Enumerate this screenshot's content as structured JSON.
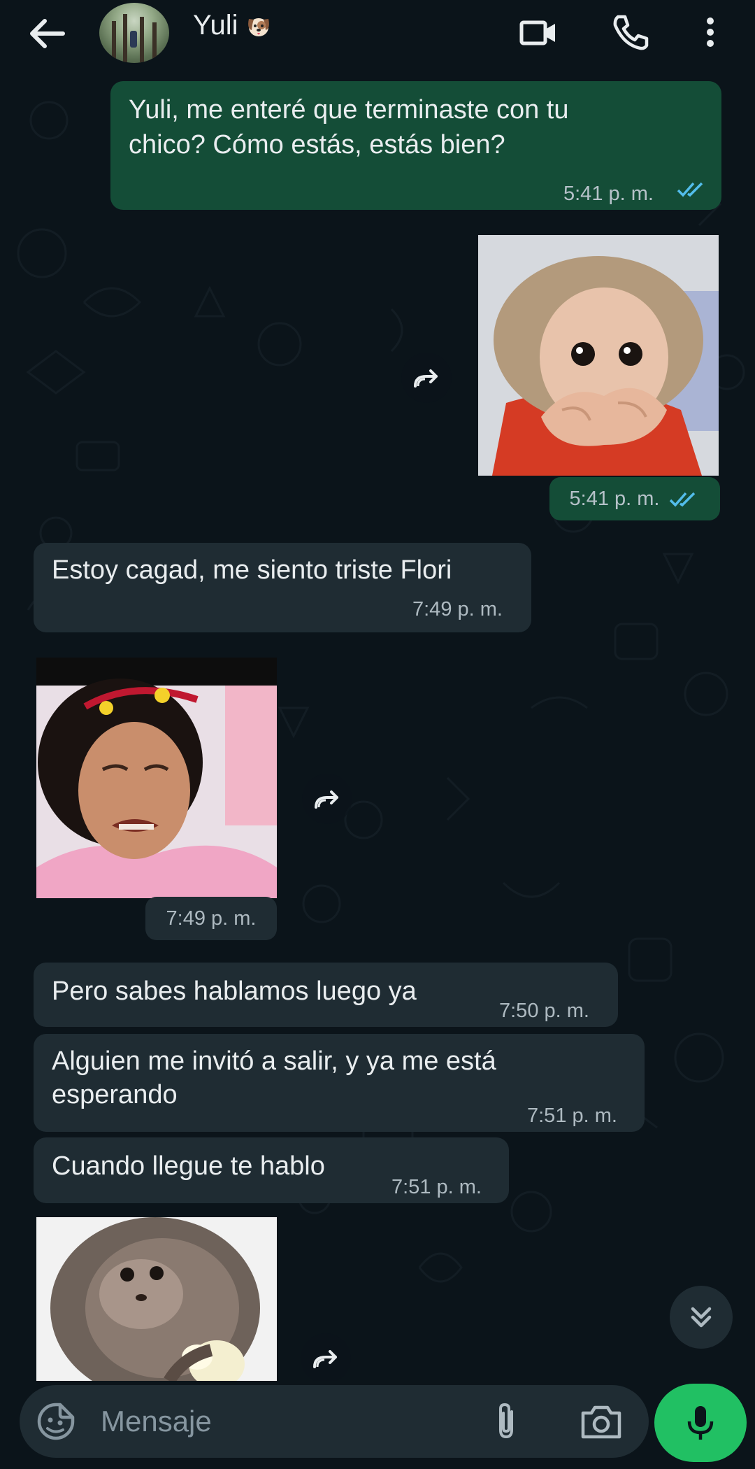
{
  "header": {
    "contact_name": "Yuli",
    "contact_emoji": "dog-face-emoji"
  },
  "messages": [
    {
      "id": "m1",
      "direction": "outgoing",
      "type": "text",
      "text_line1": "Yuli, me enteré que terminaste con tu",
      "text_line2": "chico? Cómo estás, estás bien?",
      "time": "5:41 p. m.",
      "status": "read"
    },
    {
      "id": "m2",
      "direction": "outgoing",
      "type": "sticker",
      "description": "baby-monkey-covering-mouth",
      "time": "5:41 p. m.",
      "status": "read"
    },
    {
      "id": "m3",
      "direction": "incoming",
      "type": "text",
      "text": "Estoy cagad, me siento triste Flori",
      "time": "7:49 p. m."
    },
    {
      "id": "m4",
      "direction": "incoming",
      "type": "sticker",
      "description": "crying-person-with-flower-hat",
      "time": "7:49 p. m."
    },
    {
      "id": "m5",
      "direction": "incoming",
      "type": "text",
      "text": "Pero sabes hablamos luego ya",
      "time": "7:50 p. m."
    },
    {
      "id": "m6",
      "direction": "incoming",
      "type": "text",
      "text_line1": "Alguien me invitó a salir, y ya me está",
      "text_line2": "esperando",
      "time": "7:51 p. m."
    },
    {
      "id": "m7",
      "direction": "incoming",
      "type": "text",
      "text": "Cuando llegue te hablo",
      "time": "7:51 p. m."
    },
    {
      "id": "m8",
      "direction": "incoming",
      "type": "sticker",
      "description": "monkey-eating-egg"
    }
  ],
  "composer": {
    "placeholder": "Mensaje"
  },
  "colors": {
    "background": "#0b141a",
    "outgoing_bubble": "#144d37",
    "incoming_bubble": "#1f2c33",
    "read_ticks": "#53bdeb",
    "mic_button": "#21c063"
  }
}
